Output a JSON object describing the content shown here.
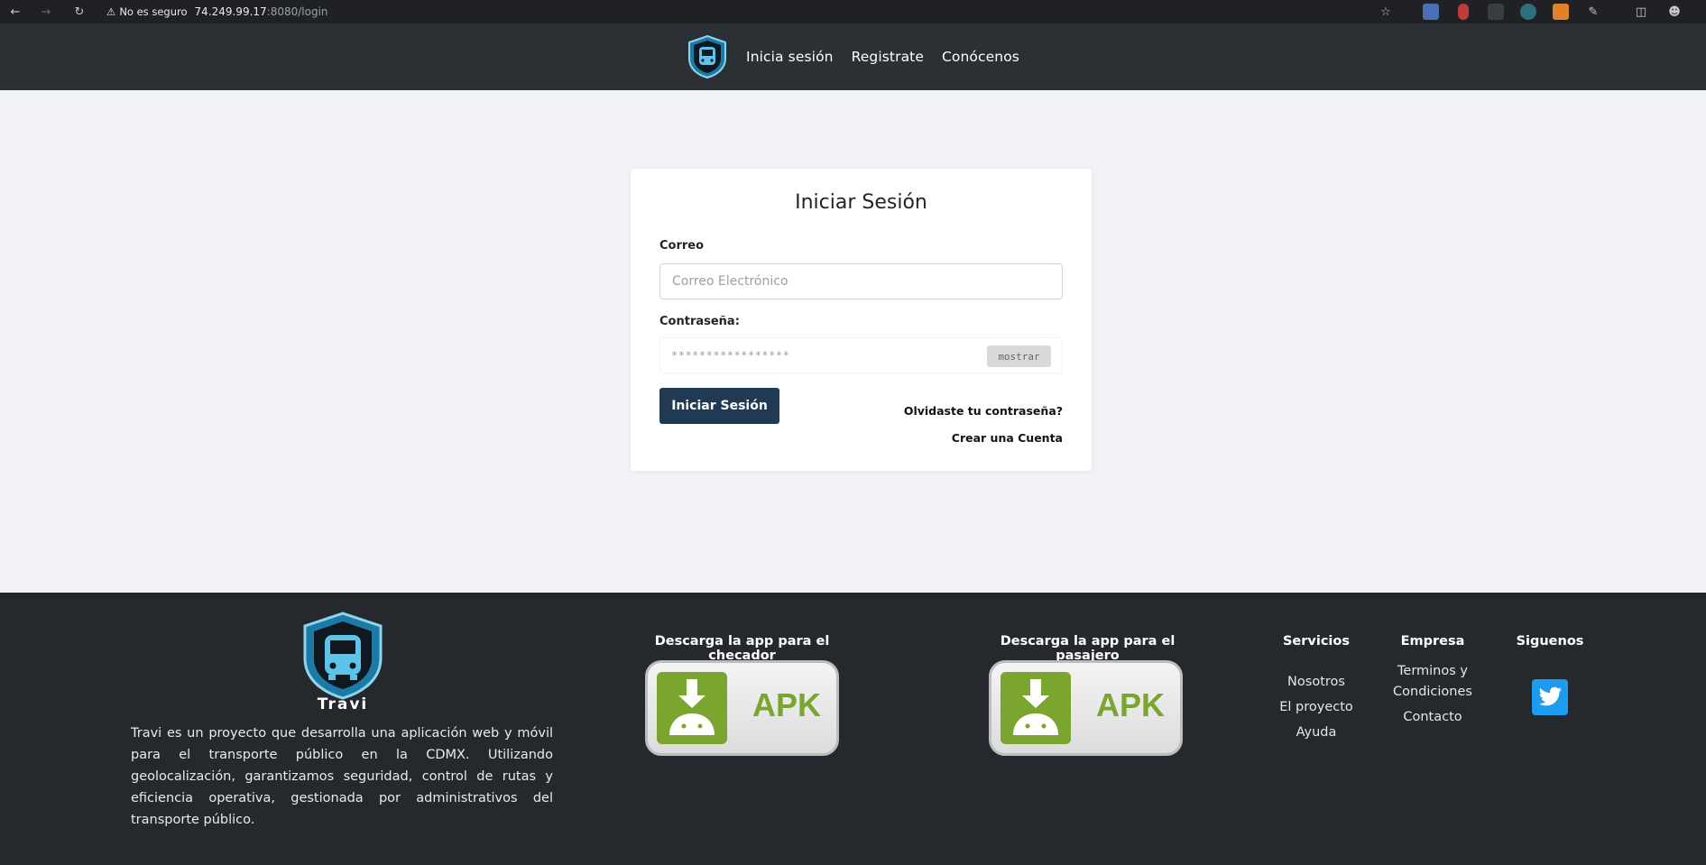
{
  "browser": {
    "security_label": "No es seguro",
    "url_host": "74.249.99.17",
    "url_path": ":8080/login"
  },
  "nav": {
    "login": "Inicia sesión",
    "register": "Registrate",
    "about": "Conócenos"
  },
  "login": {
    "title": "Iniciar Sesión",
    "email_label": "Correo",
    "email_placeholder": "Correo Electrónico",
    "password_label": "Contraseña:",
    "password_masked": "*****************",
    "show_button": "mostrar",
    "submit": "Iniciar Sesión",
    "forgot": "Olvidaste tu contraseña?",
    "create": "Crear una Cuenta"
  },
  "footer": {
    "brand": "Travi",
    "description": "Travi es un proyecto que desarrolla una aplicación web y móvil para el transporte público en la CDMX. Utilizando geolocalización, garantizamos seguridad, control de rutas y eficiencia operativa, gestionada por administrativos del transporte público.",
    "download_checker": "Descarga la app para el checador",
    "download_passenger": "Descarga la app para el pasajero",
    "apk_label": "APK",
    "services": {
      "title": "Servicios",
      "items": [
        "Nosotros",
        "El proyecto",
        "Ayuda"
      ]
    },
    "company": {
      "title": "Empresa",
      "terms_line1": "Terminos y",
      "terms_line2": "Condiciones",
      "contact": "Contacto"
    },
    "follow": {
      "title": "Siguenos"
    }
  },
  "colors": {
    "navbar": "#2b3035",
    "footer": "#25292d",
    "submit_button": "#1f3a52",
    "page_bg": "#f1f2f6",
    "android_green": "#7aa52f",
    "twitter_blue": "#1d9bf0"
  }
}
